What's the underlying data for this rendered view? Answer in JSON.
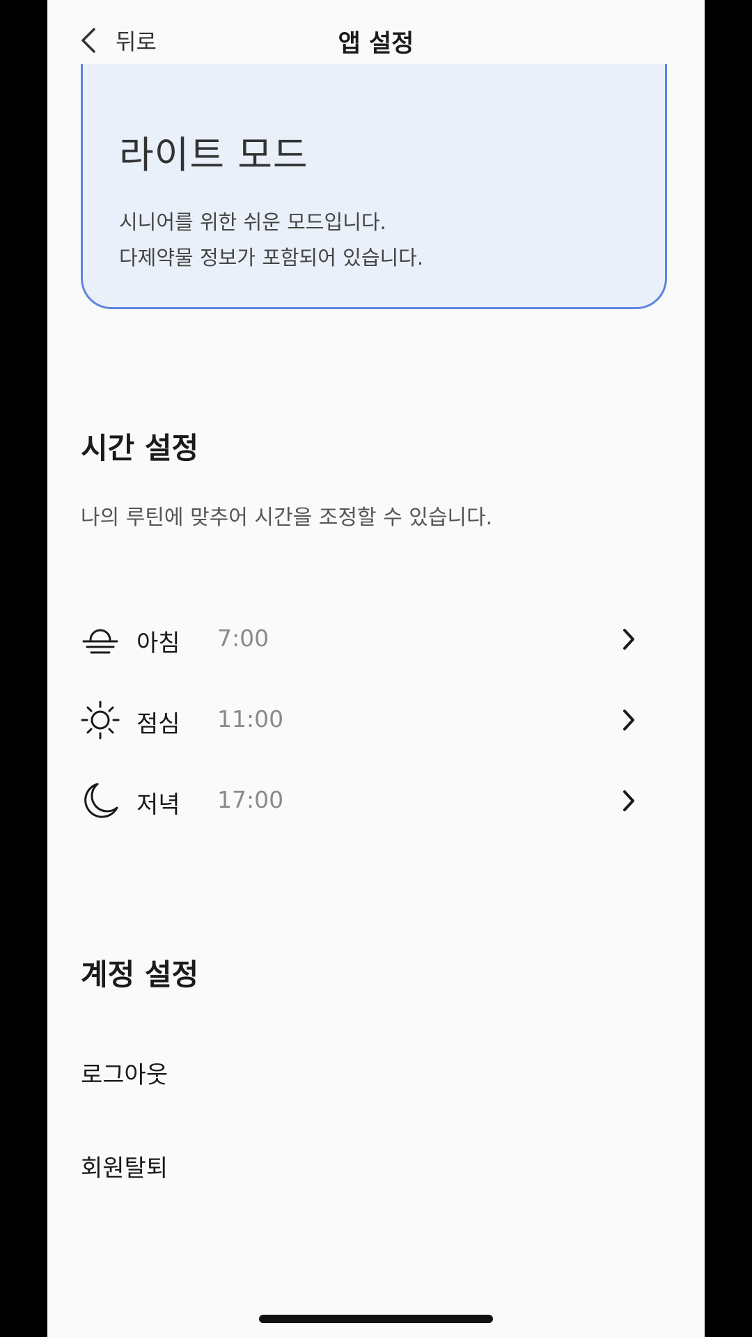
{
  "header": {
    "back_label": "뒤로",
    "title": "앱 설정"
  },
  "mode_card": {
    "title": "라이트 모드",
    "description_lines": [
      "시니어를 위한 쉬운 모드입니다.",
      "다제약물 정보가 포함되어 있습니다."
    ]
  },
  "time_settings": {
    "title": "시간 설정",
    "description": "나의 루틴에 맞추어 시간을 조정할 수 있습니다.",
    "items": [
      {
        "icon": "sunrise-icon",
        "label": "아침",
        "time": "7:00"
      },
      {
        "icon": "sun-icon",
        "label": "점심",
        "time": "11:00"
      },
      {
        "icon": "moon-icon",
        "label": "저녁",
        "time": "17:00"
      }
    ]
  },
  "account_settings": {
    "title": "계정 설정",
    "items": [
      {
        "label": "로그아웃"
      },
      {
        "label": "회원탈퇴"
      }
    ]
  },
  "colors": {
    "accent_border": "#5b86dc",
    "card_background": "#eaf0fa",
    "page_background": "#fafafa"
  }
}
